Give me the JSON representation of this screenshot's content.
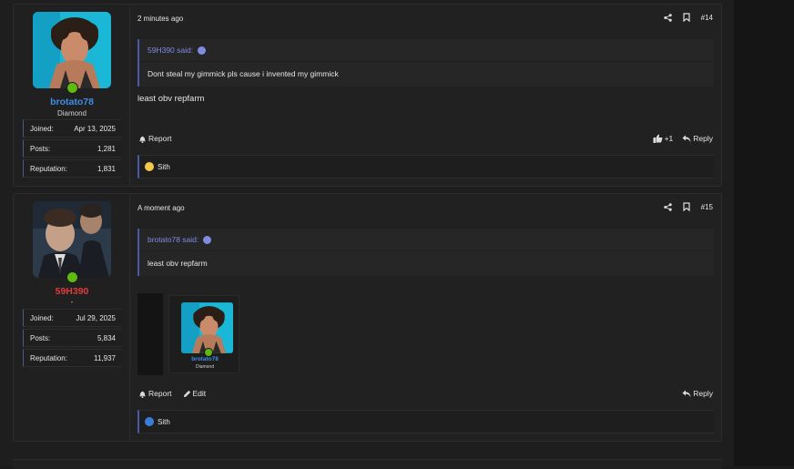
{
  "colors": {
    "username_blue": "#3f8de6",
    "username_red": "#e23b3b",
    "quote_accent": "#7f8ce0",
    "online": "#5fb90f"
  },
  "posts": [
    {
      "time": "2 minutes ago",
      "number": "#14",
      "user": {
        "name": "brotato78",
        "title": "Diamond",
        "stats": [
          {
            "label": "Joined:",
            "value": "Apr 13, 2025"
          },
          {
            "label": "Posts:",
            "value": "1,281"
          },
          {
            "label": "Reputation:",
            "value": "1,831"
          }
        ]
      },
      "quote": {
        "author": "59H390 said:",
        "text": "Dont steal my gimmick pls cause i invented my gimmick"
      },
      "text": "least obv repfarm",
      "actions": {
        "report": "Report",
        "like_count": "+1",
        "reply": "Reply"
      },
      "reaction": {
        "icon": "laugh-emoji-icon",
        "name": "Sith"
      }
    },
    {
      "time": "A moment ago",
      "number": "#15",
      "user": {
        "name": "59H390",
        "title": "-",
        "stats": [
          {
            "label": "Joined:",
            "value": "Jul 29, 2025"
          },
          {
            "label": "Posts:",
            "value": "5,834"
          },
          {
            "label": "Reputation:",
            "value": "11,937"
          }
        ]
      },
      "quote": {
        "author": "brotato78 said:",
        "text": "least obv repfarm"
      },
      "embed": {
        "name": "brotato78",
        "title": "Diamond"
      },
      "actions": {
        "report": "Report",
        "edit": "Edit",
        "reply": "Reply"
      },
      "reaction": {
        "icon": "like-icon",
        "name": "Sith"
      }
    }
  ]
}
